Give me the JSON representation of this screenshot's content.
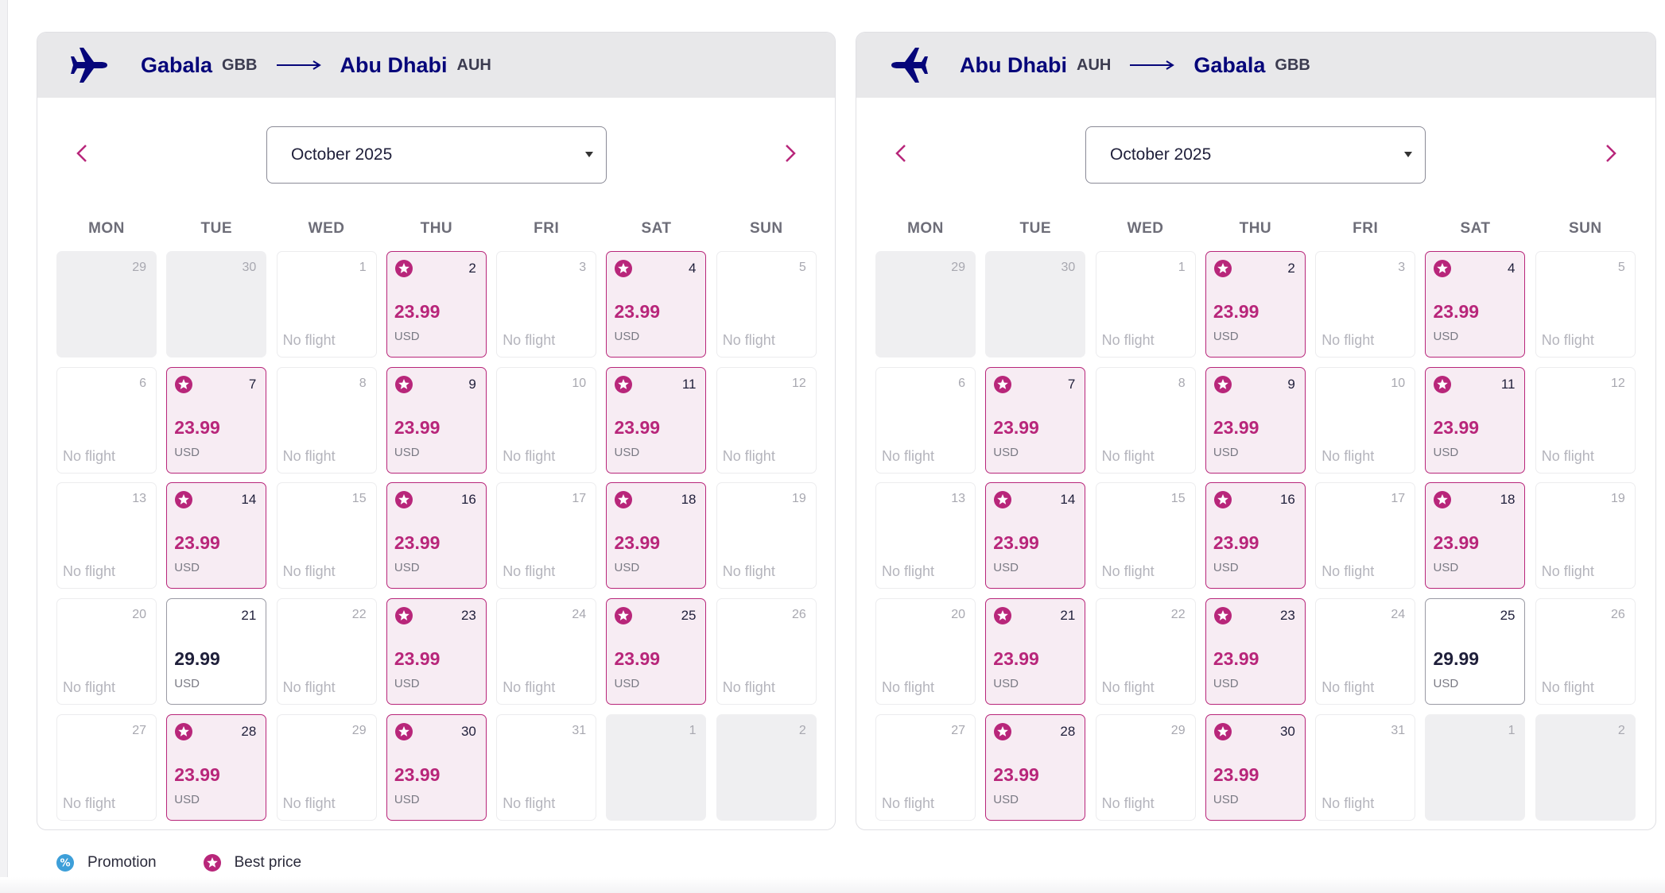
{
  "colors": {
    "brand": "#06067a",
    "best_price": "#b8267a",
    "promotion": "#3d9fd9"
  },
  "weekday_labels": [
    "MON",
    "TUE",
    "WED",
    "THU",
    "FRI",
    "SAT",
    "SUN"
  ],
  "no_flight_label": "No flight",
  "outbound": {
    "origin_city": "Gabala",
    "origin_code": "GBB",
    "dest_city": "Abu Dhabi",
    "dest_code": "AUH",
    "month": "October 2025",
    "days": [
      {
        "d": "29",
        "s": "out"
      },
      {
        "d": "30",
        "s": "out"
      },
      {
        "d": "1",
        "s": "none"
      },
      {
        "d": "2",
        "s": "best",
        "p": "23.99",
        "c": "USD"
      },
      {
        "d": "3",
        "s": "none"
      },
      {
        "d": "4",
        "s": "best",
        "p": "23.99",
        "c": "USD"
      },
      {
        "d": "5",
        "s": "none"
      },
      {
        "d": "6",
        "s": "none"
      },
      {
        "d": "7",
        "s": "best",
        "p": "23.99",
        "c": "USD"
      },
      {
        "d": "8",
        "s": "none"
      },
      {
        "d": "9",
        "s": "best",
        "p": "23.99",
        "c": "USD"
      },
      {
        "d": "10",
        "s": "none"
      },
      {
        "d": "11",
        "s": "best",
        "p": "23.99",
        "c": "USD"
      },
      {
        "d": "12",
        "s": "none"
      },
      {
        "d": "13",
        "s": "none"
      },
      {
        "d": "14",
        "s": "best",
        "p": "23.99",
        "c": "USD"
      },
      {
        "d": "15",
        "s": "none"
      },
      {
        "d": "16",
        "s": "best",
        "p": "23.99",
        "c": "USD"
      },
      {
        "d": "17",
        "s": "none"
      },
      {
        "d": "18",
        "s": "best",
        "p": "23.99",
        "c": "USD"
      },
      {
        "d": "19",
        "s": "none"
      },
      {
        "d": "20",
        "s": "none"
      },
      {
        "d": "21",
        "s": "avail",
        "p": "29.99",
        "c": "USD"
      },
      {
        "d": "22",
        "s": "none"
      },
      {
        "d": "23",
        "s": "best",
        "p": "23.99",
        "c": "USD"
      },
      {
        "d": "24",
        "s": "none"
      },
      {
        "d": "25",
        "s": "best",
        "p": "23.99",
        "c": "USD"
      },
      {
        "d": "26",
        "s": "none"
      },
      {
        "d": "27",
        "s": "none"
      },
      {
        "d": "28",
        "s": "best",
        "p": "23.99",
        "c": "USD"
      },
      {
        "d": "29",
        "s": "none"
      },
      {
        "d": "30",
        "s": "best",
        "p": "23.99",
        "c": "USD"
      },
      {
        "d": "31",
        "s": "none"
      },
      {
        "d": "1",
        "s": "out"
      },
      {
        "d": "2",
        "s": "out"
      }
    ]
  },
  "return": {
    "origin_city": "Abu Dhabi",
    "origin_code": "AUH",
    "dest_city": "Gabala",
    "dest_code": "GBB",
    "month": "October 2025",
    "days": [
      {
        "d": "29",
        "s": "out"
      },
      {
        "d": "30",
        "s": "out"
      },
      {
        "d": "1",
        "s": "none"
      },
      {
        "d": "2",
        "s": "best",
        "p": "23.99",
        "c": "USD"
      },
      {
        "d": "3",
        "s": "none"
      },
      {
        "d": "4",
        "s": "best",
        "p": "23.99",
        "c": "USD"
      },
      {
        "d": "5",
        "s": "none"
      },
      {
        "d": "6",
        "s": "none"
      },
      {
        "d": "7",
        "s": "best",
        "p": "23.99",
        "c": "USD"
      },
      {
        "d": "8",
        "s": "none"
      },
      {
        "d": "9",
        "s": "best",
        "p": "23.99",
        "c": "USD"
      },
      {
        "d": "10",
        "s": "none"
      },
      {
        "d": "11",
        "s": "best",
        "p": "23.99",
        "c": "USD"
      },
      {
        "d": "12",
        "s": "none"
      },
      {
        "d": "13",
        "s": "none"
      },
      {
        "d": "14",
        "s": "best",
        "p": "23.99",
        "c": "USD"
      },
      {
        "d": "15",
        "s": "none"
      },
      {
        "d": "16",
        "s": "best",
        "p": "23.99",
        "c": "USD"
      },
      {
        "d": "17",
        "s": "none"
      },
      {
        "d": "18",
        "s": "best",
        "p": "23.99",
        "c": "USD"
      },
      {
        "d": "19",
        "s": "none"
      },
      {
        "d": "20",
        "s": "none"
      },
      {
        "d": "21",
        "s": "best",
        "p": "23.99",
        "c": "USD"
      },
      {
        "d": "22",
        "s": "none"
      },
      {
        "d": "23",
        "s": "best",
        "p": "23.99",
        "c": "USD"
      },
      {
        "d": "24",
        "s": "none"
      },
      {
        "d": "25",
        "s": "avail",
        "p": "29.99",
        "c": "USD"
      },
      {
        "d": "26",
        "s": "none"
      },
      {
        "d": "27",
        "s": "none"
      },
      {
        "d": "28",
        "s": "best",
        "p": "23.99",
        "c": "USD"
      },
      {
        "d": "29",
        "s": "none"
      },
      {
        "d": "30",
        "s": "best",
        "p": "23.99",
        "c": "USD"
      },
      {
        "d": "31",
        "s": "none"
      },
      {
        "d": "1",
        "s": "out"
      },
      {
        "d": "2",
        "s": "out"
      }
    ]
  },
  "legend": {
    "promotion_label": "Promotion",
    "best_price_label": "Best price"
  }
}
